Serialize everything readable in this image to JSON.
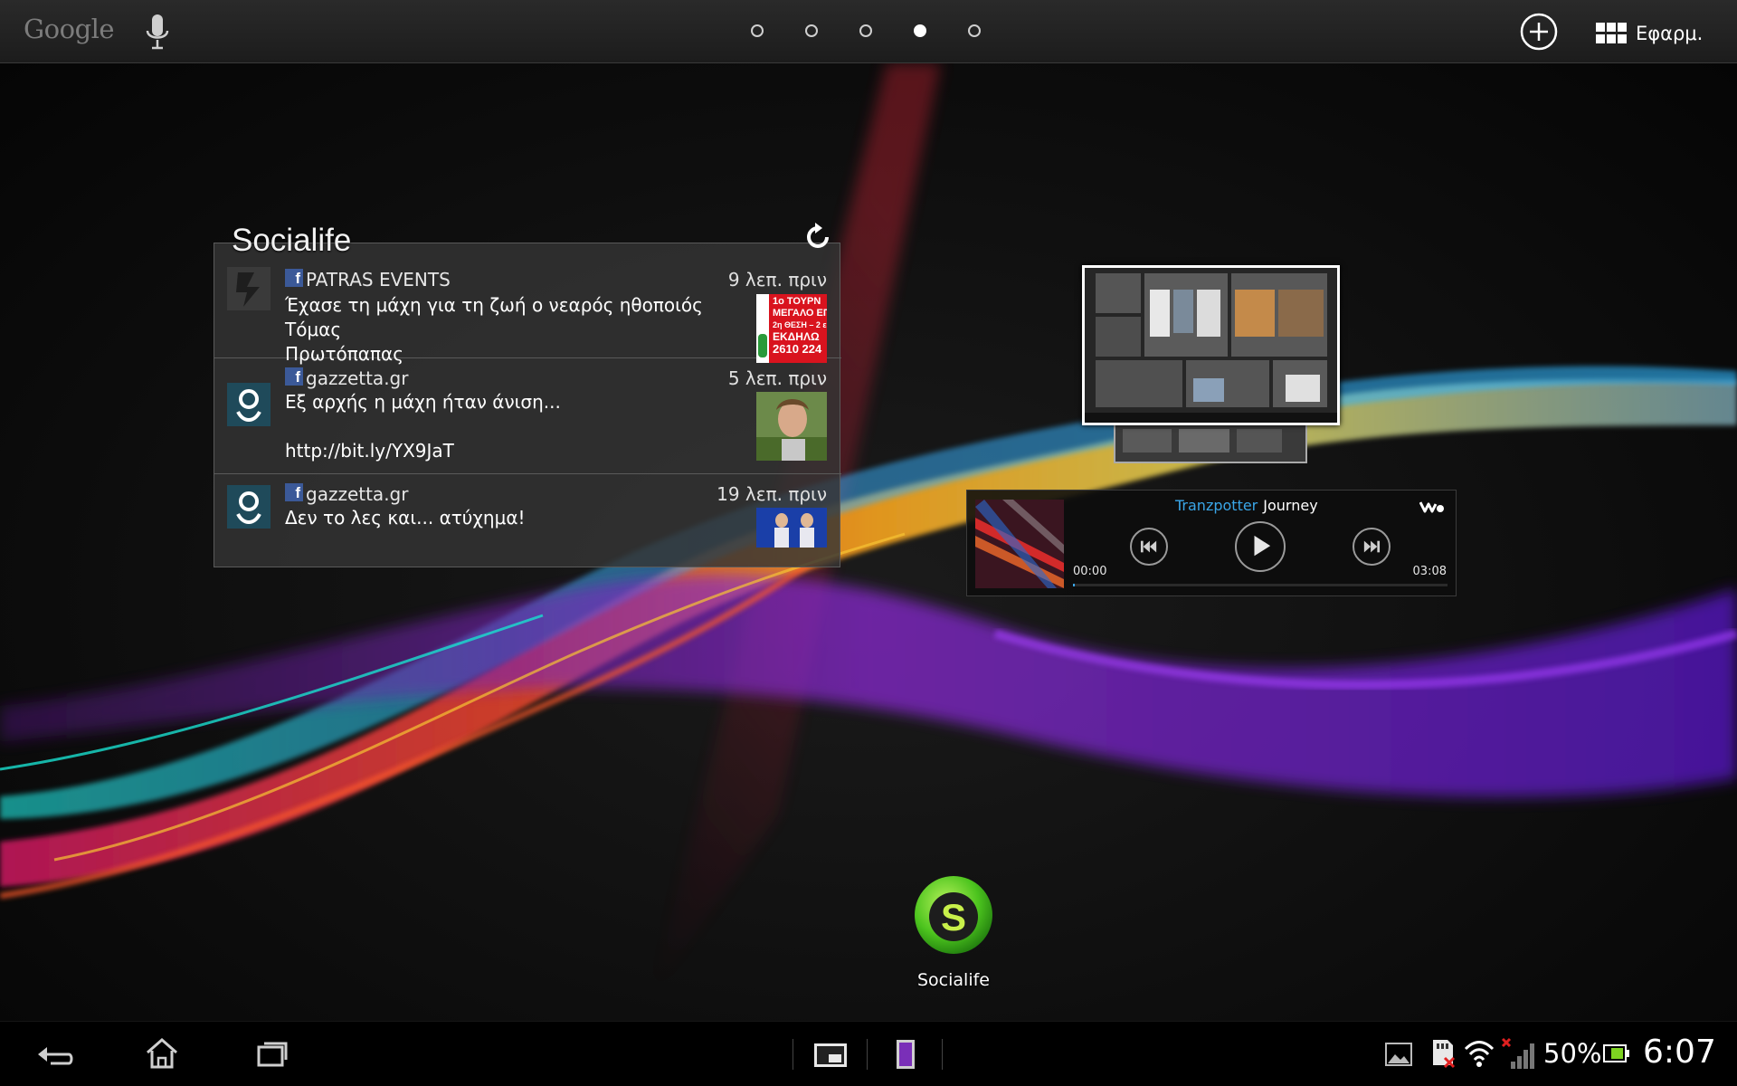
{
  "top_bar": {
    "search_logo": "Google",
    "page_indicator": {
      "count": 5,
      "active_index": 3
    },
    "apps_label": "Εφαρμ.",
    "icons": [
      "microphone-icon",
      "add-icon",
      "apps-grid-icon"
    ]
  },
  "socialife_widget": {
    "title": "Socialife",
    "items": [
      {
        "source": "PATRAS EVENTS",
        "time": "9 λεπ. πριν",
        "text": "Έχασε τη μάχη για τη ζωή ο νεαρός ηθοποιός Τόμας\nΠρωτόπαπας\n...",
        "avatar_icon": "patras-events-avatar",
        "thumb_text": [
          "1ο ΤΟΥΡΝ",
          "ΜΕΓΑΛΟ ΕΠ",
          "2η ΘΕΣΗ – 2 ε",
          "ΕΚΔΗΛΩ",
          "2610 224"
        ]
      },
      {
        "source": "gazzetta.gr",
        "time": "5 λεπ. πριν",
        "text": "Εξ αρχής η μάχη ήταν άνιση...\n\nhttp://bit.ly/YX9JaT",
        "avatar_icon": "gazzetta-avatar"
      },
      {
        "source": "gazzetta.gr",
        "time": "19 λεπ. πριν",
        "text": "Δεν το λες και... ατύχημα!",
        "avatar_icon": "gazzetta-avatar"
      }
    ]
  },
  "music_widget": {
    "artist": "Tranzpotter",
    "title": "Journey",
    "elapsed": "00:00",
    "duration": "03:08",
    "progress": 0.005,
    "accent_color": "#3aa6e8"
  },
  "app_shortcut": {
    "label": "Socialife",
    "icon": "socialife-app-icon"
  },
  "status_bar": {
    "battery_percent": "50%",
    "clock": "6:07",
    "icons": [
      "gallery-icon",
      "sd-card-error-icon",
      "wifi-icon",
      "no-signal-icon",
      "battery-icon"
    ]
  },
  "nav_bar": {
    "icons": [
      "back-icon",
      "home-icon",
      "recent-apps-icon",
      "small-app-window-icon",
      "small-app-remote-icon"
    ]
  }
}
